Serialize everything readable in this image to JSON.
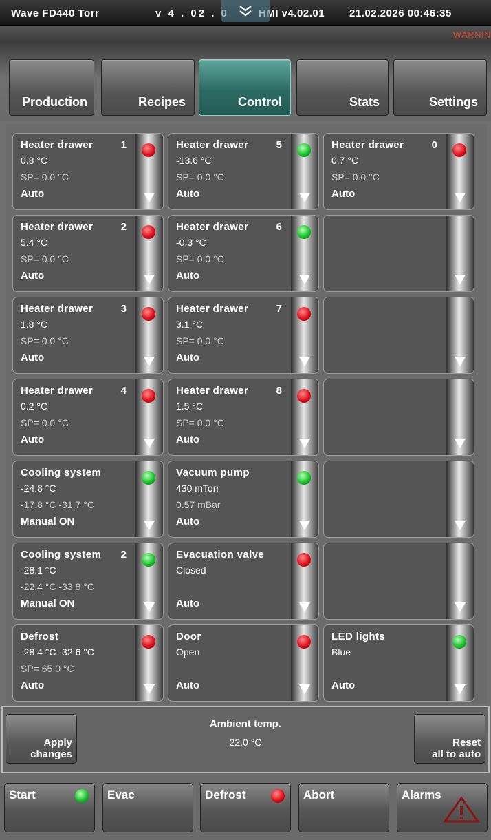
{
  "header": {
    "title": "Wave FD440 Torr",
    "version": "v 4 .  02 .  0",
    "hmi": "HMI v4.02.01",
    "datetime": "21.02.2026 00:46:35",
    "warning": "WARNIN"
  },
  "tabs": [
    {
      "label": "Production"
    },
    {
      "label": "Recipes"
    },
    {
      "label": "Control",
      "active": true
    },
    {
      "label": "Stats"
    },
    {
      "label": "Settings"
    }
  ],
  "tiles": [
    {
      "name": "Heater drawer",
      "num": "1",
      "l2": "0.8 °C",
      "l3": "SP= 0.0 °C",
      "l4": "Auto",
      "led": "red"
    },
    {
      "name": "Heater drawer",
      "num": "5",
      "l2": "-13.6 °C",
      "l3": "SP= 0.0 °C",
      "l4": "Auto",
      "led": "green"
    },
    {
      "name": "Heater drawer",
      "num": "0",
      "l2": "0.7 °C",
      "l3": "SP= 0.0 °C",
      "l4": "Auto",
      "led": "red"
    },
    {
      "name": "Heater drawer",
      "num": "2",
      "l2": "5.4 °C",
      "l3": "SP= 0.0 °C",
      "l4": "Auto",
      "led": "red"
    },
    {
      "name": "Heater drawer",
      "num": "6",
      "l2": "-0.3 °C",
      "l3": "SP= 0.0 °C",
      "l4": "Auto",
      "led": "green"
    },
    {
      "name": "",
      "num": "",
      "l2": "",
      "l3": "",
      "l4": "",
      "led": ""
    },
    {
      "name": "Heater drawer",
      "num": "3",
      "l2": "1.8 °C",
      "l3": "SP= 0.0 °C",
      "l4": "Auto",
      "led": "red"
    },
    {
      "name": "Heater drawer",
      "num": "7",
      "l2": "3.1 °C",
      "l3": "SP= 0.0 °C",
      "l4": "Auto",
      "led": "red"
    },
    {
      "name": "",
      "num": "",
      "l2": "",
      "l3": "",
      "l4": "",
      "led": ""
    },
    {
      "name": "Heater drawer",
      "num": "4",
      "l2": "0.2 °C",
      "l3": "SP= 0.0 °C",
      "l4": "Auto",
      "led": "red"
    },
    {
      "name": "Heater drawer",
      "num": "8",
      "l2": "1.5 °C",
      "l3": "SP= 0.0 °C",
      "l4": "Auto",
      "led": "red"
    },
    {
      "name": "",
      "num": "",
      "l2": "",
      "l3": "",
      "l4": "",
      "led": ""
    },
    {
      "name": "Cooling system",
      "num": "",
      "l2": "-24.8 °C",
      "l3": "-17.8 °C    -31.7 °C",
      "l4": "Manual ON",
      "led": "green"
    },
    {
      "name": "Vacuum pump",
      "num": "",
      "l2": "430 mTorr",
      "l3": "0.57 mBar",
      "l4": "Auto",
      "led": "green"
    },
    {
      "name": "",
      "num": "",
      "l2": "",
      "l3": "",
      "l4": "",
      "led": ""
    },
    {
      "name": "Cooling system",
      "num": "2",
      "l2": "-28.1 °C",
      "l3": "-22.4 °C    -33.8 °C",
      "l4": "Manual ON",
      "led": "green"
    },
    {
      "name": "Evacuation valve",
      "num": "",
      "l2": "Closed",
      "l3": "",
      "l4": "Auto",
      "led": "red"
    },
    {
      "name": "",
      "num": "",
      "l2": "",
      "l3": "",
      "l4": "",
      "led": ""
    },
    {
      "name": "Defrost",
      "num": "",
      "l2": "-28.4 °C    -32.6 °C",
      "l3": "SP= 65.0 °C",
      "l4": "Auto",
      "led": "red"
    },
    {
      "name": "Door",
      "num": "",
      "l2": "Open",
      "l3": "",
      "l4": "Auto",
      "led": "red"
    },
    {
      "name": "LED lights",
      "num": "",
      "l2": "Blue",
      "l3": "",
      "l4": "Auto",
      "led": "green"
    }
  ],
  "panel": {
    "apply": "Apply\nchanges",
    "ambient_label": "Ambient temp.",
    "ambient_value": "22.0 °C",
    "reset": "Reset\nall to auto"
  },
  "footer": [
    {
      "label": "Start",
      "led": "green"
    },
    {
      "label": "Evac",
      "led": ""
    },
    {
      "label": "Defrost",
      "led": "red"
    },
    {
      "label": "Abort",
      "led": ""
    },
    {
      "label": "Alarms",
      "icon": "warning-triangle-icon"
    }
  ]
}
